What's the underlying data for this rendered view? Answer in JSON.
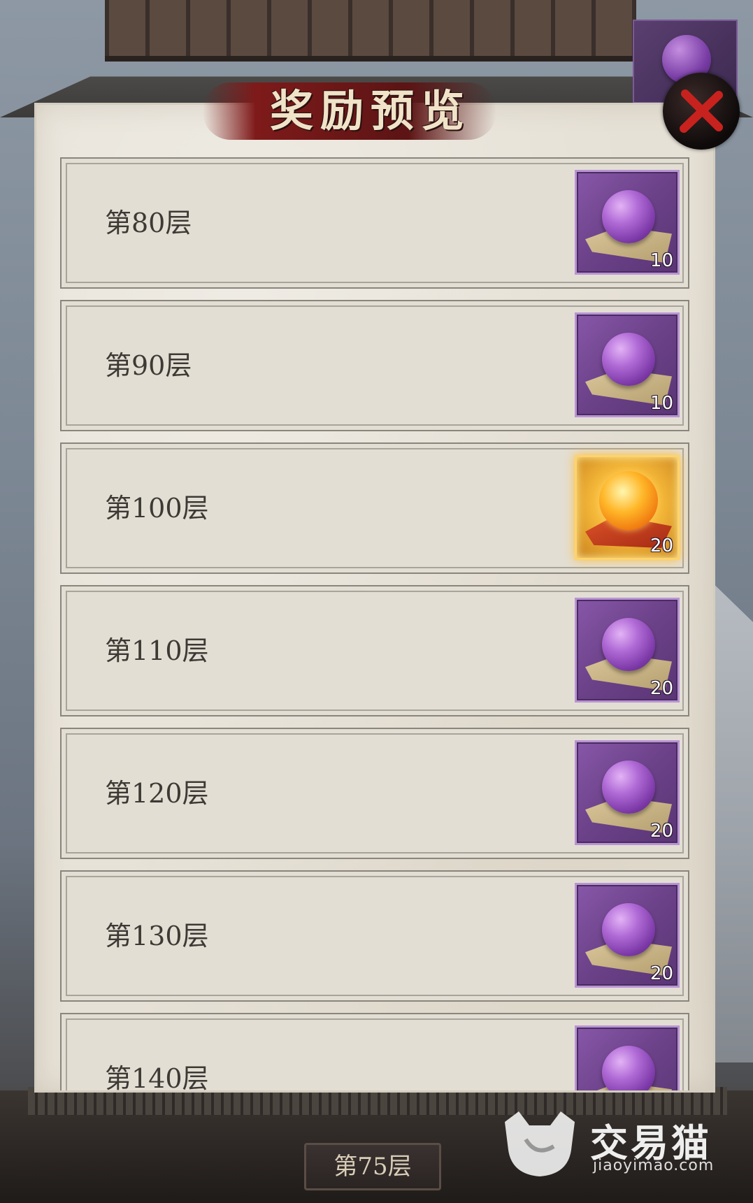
{
  "dialog": {
    "title": "奖励预览"
  },
  "rows": [
    {
      "label": "第80层",
      "reward": {
        "type": "purple-orb",
        "qty": "10"
      }
    },
    {
      "label": "第90层",
      "reward": {
        "type": "purple-orb",
        "qty": "10"
      }
    },
    {
      "label": "第100层",
      "reward": {
        "type": "gold-orb",
        "qty": "20"
      }
    },
    {
      "label": "第110层",
      "reward": {
        "type": "purple-orb",
        "qty": "20"
      }
    },
    {
      "label": "第120层",
      "reward": {
        "type": "purple-orb",
        "qty": "20"
      }
    },
    {
      "label": "第130层",
      "reward": {
        "type": "purple-orb",
        "qty": "20"
      }
    },
    {
      "label": "第140层",
      "reward": {
        "type": "purple-orb",
        "qty": ""
      }
    }
  ],
  "current_floor": "第75层",
  "watermark": {
    "cn": "交易猫",
    "en": "jiaoyimao.com"
  },
  "colors": {
    "panel": "#e6e1d6",
    "banner": "#7e1a1a",
    "purple_item": "#6b4188",
    "gold_item": "#f5b93a",
    "close_x": "#c8221f"
  },
  "icons": {
    "close": "close-icon",
    "purple_orb": "purple-orb-icon",
    "gold_orb": "gold-orb-icon"
  }
}
